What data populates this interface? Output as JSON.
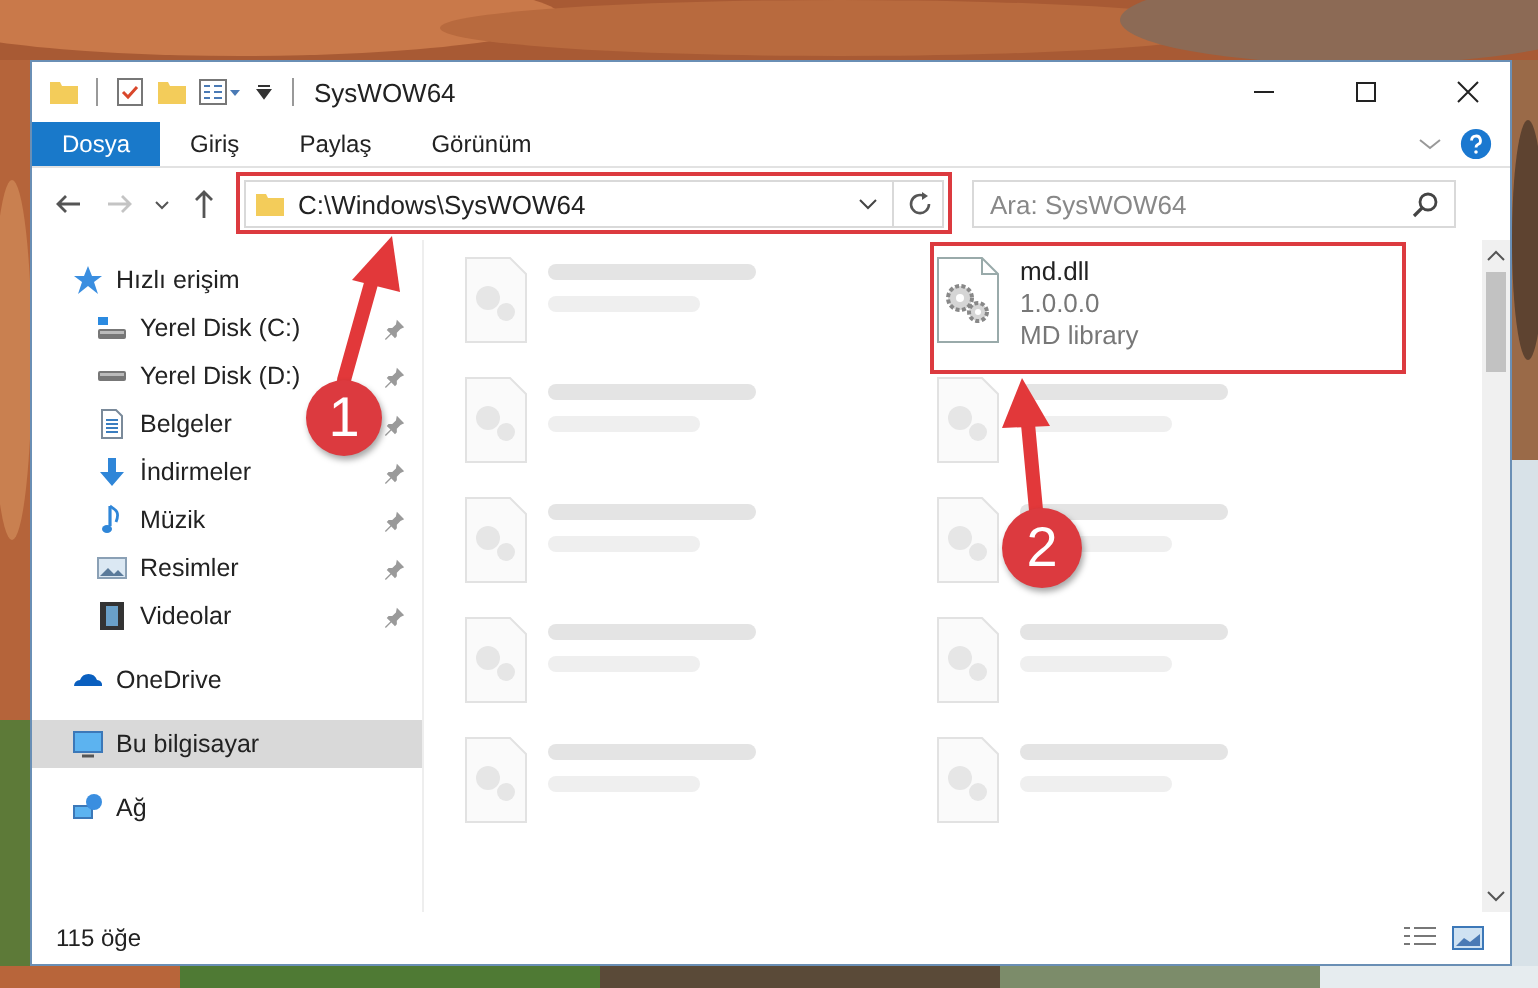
{
  "window": {
    "title": "SysWOW64"
  },
  "ribbon_tabs": [
    {
      "label": "Dosya",
      "selected": true
    },
    {
      "label": "Giriş",
      "selected": false
    },
    {
      "label": "Paylaş",
      "selected": false
    },
    {
      "label": "Görünüm",
      "selected": false
    }
  ],
  "address": {
    "path": "C:\\Windows\\SysWOW64",
    "search_placeholder": "Ara: SysWOW64"
  },
  "sidebar": {
    "items": [
      {
        "label": "Hızlı erişim",
        "selected": false,
        "children": [
          {
            "label": "Yerel Disk (C:)",
            "selected": false,
            "pinned": true
          },
          {
            "label": "Yerel Disk (D:)",
            "selected": false,
            "pinned": true
          },
          {
            "label": "Belgeler",
            "selected": false,
            "pinned": true
          },
          {
            "label": "İndirmeler",
            "selected": false,
            "pinned": true
          },
          {
            "label": "Müzik",
            "selected": false,
            "pinned": true
          },
          {
            "label": "Resimler",
            "selected": false,
            "pinned": true
          },
          {
            "label": "Videolar",
            "selected": false,
            "pinned": true
          }
        ]
      },
      {
        "label": "OneDrive",
        "selected": false
      },
      {
        "label": "Bu bilgisayar",
        "selected": true
      },
      {
        "label": "Ağ",
        "selected": false
      }
    ]
  },
  "files": [
    {
      "kind": "blurred"
    },
    {
      "kind": "highlighted",
      "name": "md.dll",
      "lines": [
        "1.0.0.0",
        "MD library"
      ]
    },
    {
      "kind": "blurred"
    },
    {
      "kind": "blurred"
    },
    {
      "kind": "blurred"
    },
    {
      "kind": "blurred"
    },
    {
      "kind": "blurred"
    },
    {
      "kind": "blurred"
    },
    {
      "kind": "blurred"
    },
    {
      "kind": "blurred"
    }
  ],
  "status_bar": {
    "item_count": "115 öğe"
  },
  "annotations": [
    {
      "label": "1"
    },
    {
      "label": "2"
    }
  ]
}
